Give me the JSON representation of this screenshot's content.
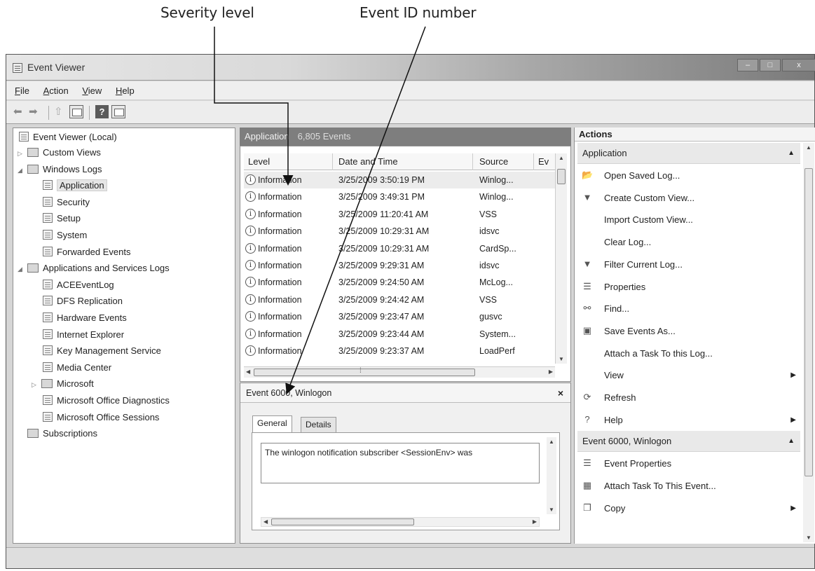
{
  "callouts": {
    "severity": "Severity level",
    "event_id": "Event ID number"
  },
  "window": {
    "title": "Event Viewer",
    "controls": [
      "–",
      "□",
      "x"
    ]
  },
  "menu": [
    "File",
    "Action",
    "View",
    "Help"
  ],
  "toolbar": {
    "icons": [
      "back-icon",
      "forward-icon",
      "up-icon",
      "show-hide-pane-icon",
      "help-icon",
      "properties-pane-icon"
    ]
  },
  "tree": {
    "root": "Event Viewer (Local)",
    "items": [
      {
        "label": "Custom Views",
        "level": 1,
        "expander": "▷"
      },
      {
        "label": "Windows Logs",
        "level": 1,
        "expander": "◢"
      },
      {
        "label": "Application",
        "level": 2,
        "selected": true
      },
      {
        "label": "Security",
        "level": 2
      },
      {
        "label": "Setup",
        "level": 2
      },
      {
        "label": "System",
        "level": 2
      },
      {
        "label": "Forwarded Events",
        "level": 2
      },
      {
        "label": "Applications and Services Logs",
        "level": 1,
        "expander": "◢"
      },
      {
        "label": "ACEEventLog",
        "level": 2
      },
      {
        "label": "DFS Replication",
        "level": 2
      },
      {
        "label": "Hardware Events",
        "level": 2
      },
      {
        "label": "Internet Explorer",
        "level": 2
      },
      {
        "label": "Key Management Service",
        "level": 2
      },
      {
        "label": "Media Center",
        "level": 2
      },
      {
        "label": "Microsoft",
        "level": 2,
        "expander": "▷"
      },
      {
        "label": "Microsoft Office Diagnostics",
        "level": 2
      },
      {
        "label": "Microsoft Office Sessions",
        "level": 2
      },
      {
        "label": "Subscriptions",
        "level": 1
      }
    ]
  },
  "log": {
    "name": "Application",
    "count": "6,805 Events",
    "columns": [
      "Level",
      "Date and Time",
      "Source",
      "Ev"
    ],
    "rows": [
      {
        "level": "Information",
        "datetime": "3/25/2009 3:50:19 PM",
        "source": "Winlog..."
      },
      {
        "level": "Information",
        "datetime": "3/25/2009 3:49:31 PM",
        "source": "Winlog..."
      },
      {
        "level": "Information",
        "datetime": "3/25/2009 11:20:41 AM",
        "source": "VSS"
      },
      {
        "level": "Information",
        "datetime": "3/25/2009 10:29:31 AM",
        "source": "idsvc"
      },
      {
        "level": "Information",
        "datetime": "3/25/2009 10:29:31 AM",
        "source": "CardSp..."
      },
      {
        "level": "Information",
        "datetime": "3/25/2009 9:29:31 AM",
        "source": "idsvc"
      },
      {
        "level": "Information",
        "datetime": "3/25/2009 9:24:50 AM",
        "source": "McLog..."
      },
      {
        "level": "Information",
        "datetime": "3/25/2009 9:24:42 AM",
        "source": "VSS"
      },
      {
        "level": "Information",
        "datetime": "3/25/2009 9:23:47 AM",
        "source": "gusvc"
      },
      {
        "level": "Information",
        "datetime": "3/25/2009 9:23:44 AM",
        "source": "System..."
      },
      {
        "level": "Information",
        "datetime": "3/25/2009 9:23:37 AM",
        "source": "LoadPerf"
      }
    ]
  },
  "detail": {
    "title": "Event 6000, Winlogon",
    "close": "×",
    "tabs": [
      "General",
      "Details"
    ],
    "message": "The winlogon notification subscriber <SessionEnv> was"
  },
  "actions": {
    "title": "Actions",
    "sections": [
      {
        "label": "Application",
        "items": [
          {
            "label": "Open Saved Log...",
            "icon": "open-log-icon"
          },
          {
            "label": "Create Custom View...",
            "icon": "filter-icon"
          },
          {
            "label": "Import Custom View...",
            "icon": ""
          },
          {
            "label": "Clear Log...",
            "icon": ""
          },
          {
            "label": "Filter Current Log...",
            "icon": "filter-icon"
          },
          {
            "label": "Properties",
            "icon": "properties-icon"
          },
          {
            "label": "Find...",
            "icon": "binoculars-icon"
          },
          {
            "label": "Save Events As...",
            "icon": "save-icon"
          },
          {
            "label": "Attach a Task To this Log...",
            "icon": ""
          },
          {
            "label": "View",
            "icon": "",
            "submenu": true
          },
          {
            "label": "Refresh",
            "icon": "refresh-icon"
          },
          {
            "label": "Help",
            "icon": "help-icon",
            "submenu": true
          }
        ]
      },
      {
        "label": "Event 6000, Winlogon",
        "items": [
          {
            "label": "Event Properties",
            "icon": "properties-icon"
          },
          {
            "label": "Attach Task To This Event...",
            "icon": "task-icon"
          },
          {
            "label": "Copy",
            "icon": "copy-icon",
            "submenu": true
          }
        ]
      }
    ]
  }
}
